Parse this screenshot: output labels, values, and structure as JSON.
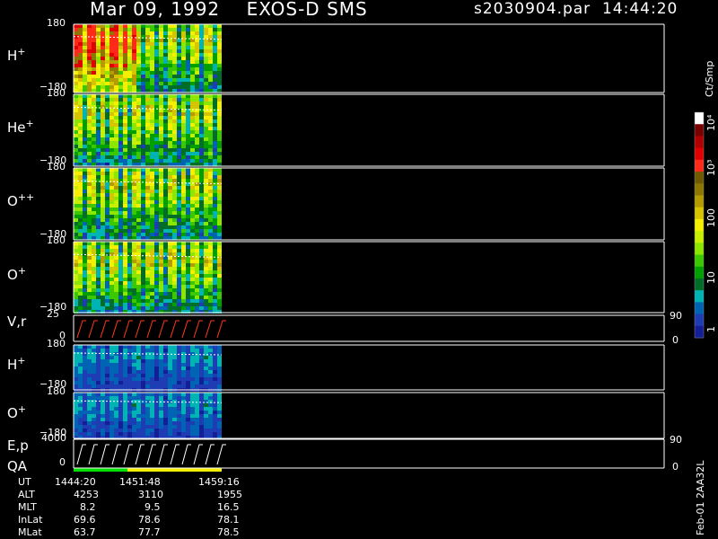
{
  "title": {
    "date": "Mar 09, 1992",
    "instrument": "EXOS-D SMS",
    "file": "s2030904.par",
    "time": "14:44:20"
  },
  "panels": [
    {
      "label": "H",
      "sup": "+",
      "top": "180",
      "bottom": "−180"
    },
    {
      "label": "He",
      "sup": "+",
      "top": "180",
      "bottom": "−180"
    },
    {
      "label": "O",
      "sup": "++",
      "top": "180",
      "bottom": "−180"
    },
    {
      "label": "O",
      "sup": "+",
      "top": "180",
      "bottom": "−180"
    },
    {
      "label": "V,r",
      "sup": "",
      "top": "25",
      "bottom": "0",
      "right_top": "90",
      "right_bottom": "0"
    },
    {
      "label": "H",
      "sup": "+",
      "top": "180",
      "bottom": "−180"
    },
    {
      "label": "O",
      "sup": "+",
      "top": "180",
      "bottom": "−180"
    },
    {
      "label": "E,p",
      "sup": "",
      "top": "4000",
      "bottom": "0",
      "right_top": "90",
      "right_bottom": "0"
    }
  ],
  "qa_label": "QA",
  "colorbar": {
    "unit": "Ct/Smp",
    "labels": [
      "10⁴",
      "10³",
      "100",
      "10",
      "1"
    ],
    "colors": [
      "#ffffff",
      "#7a0000",
      "#b00000",
      "#e00000",
      "#ff2a1a",
      "#6e5a00",
      "#8c7800",
      "#b49b00",
      "#d7c400",
      "#f5f000",
      "#c8f000",
      "#8ce600",
      "#3cc800",
      "#00a000",
      "#006e28",
      "#00b4b4",
      "#0064b4",
      "#1e3cb4",
      "#141e96"
    ]
  },
  "footer": {
    "rows": [
      {
        "name": "UT",
        "values": [
          "1444:20",
          "1451:48",
          "1459:16"
        ]
      },
      {
        "name": "ALT",
        "values": [
          "4253",
          "3110",
          "1955"
        ]
      },
      {
        "name": "MLT",
        "values": [
          "8.2",
          "9.5",
          "16.5"
        ]
      },
      {
        "name": "InLat",
        "values": [
          "69.6",
          "78.6",
          "78.1"
        ]
      },
      {
        "name": "MLat",
        "values": [
          "63.7",
          "77.7",
          "78.5"
        ]
      }
    ],
    "stamp": "Feb-01 2AA32L"
  },
  "chart_data": {
    "type": "heatmap",
    "title": "Mar 09, 1992   EXOS-D SMS",
    "x": [
      "1444:20",
      "1451:48",
      "1459:16"
    ],
    "panels": [
      {
        "name": "H+",
        "ylim": [
          -180,
          180
        ]
      },
      {
        "name": "He+",
        "ylim": [
          -180,
          180
        ]
      },
      {
        "name": "O++",
        "ylim": [
          -180,
          180
        ]
      },
      {
        "name": "O+",
        "ylim": [
          -180,
          180
        ]
      },
      {
        "name": "V,r",
        "ylim": [
          0,
          25
        ],
        "y2lim": [
          0,
          90
        ]
      },
      {
        "name": "H+",
        "ylim": [
          -180,
          180
        ]
      },
      {
        "name": "O+",
        "ylim": [
          -180,
          180
        ]
      },
      {
        "name": "E,p",
        "ylim": [
          0,
          4000
        ],
        "y2lim": [
          0,
          90
        ]
      }
    ],
    "colorbar": {
      "unit": "Ct/Smp",
      "scale": "log",
      "range": [
        1,
        10000
      ]
    }
  }
}
